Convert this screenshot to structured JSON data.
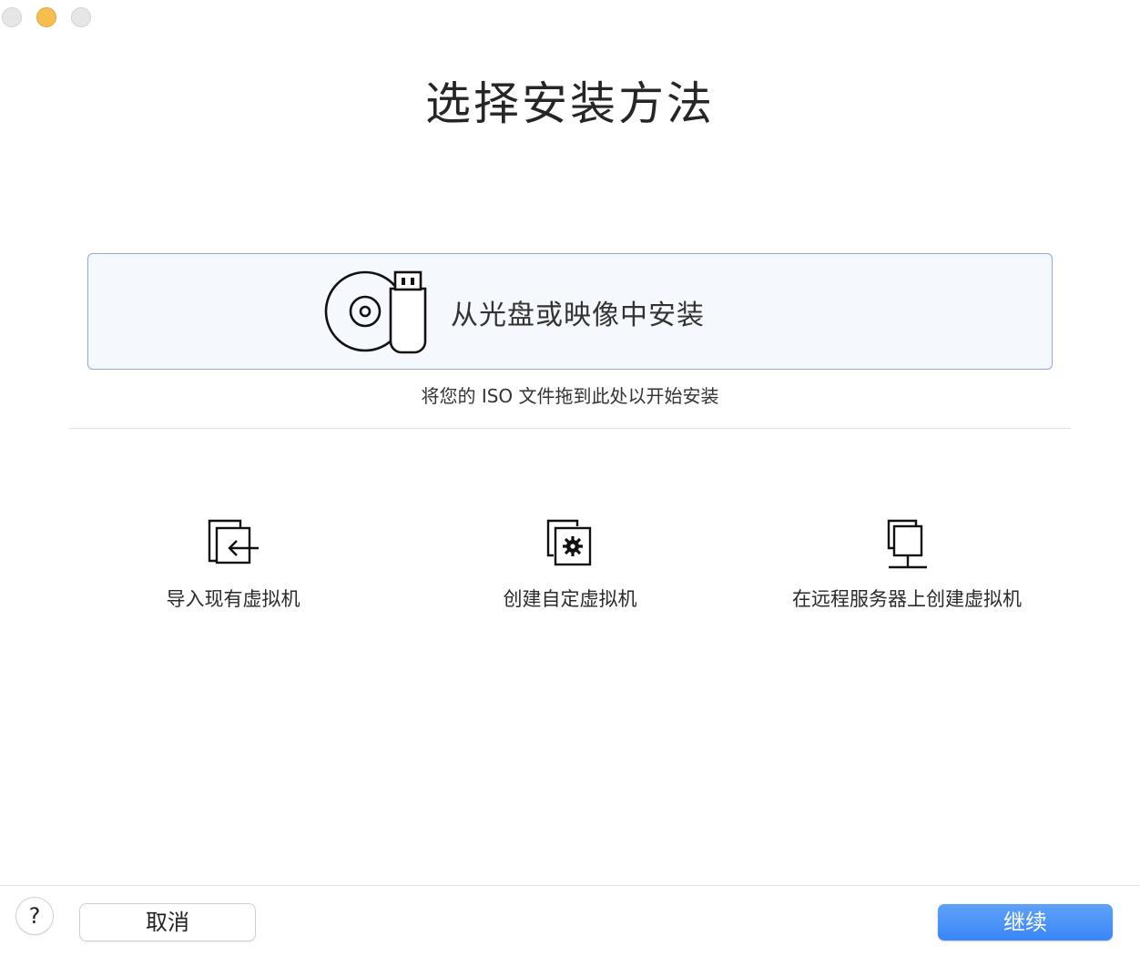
{
  "window": {
    "controls": [
      "close",
      "minimize",
      "zoom"
    ]
  },
  "header": {
    "title": "选择安装方法"
  },
  "install_card": {
    "label": "从光盘或映像中安装",
    "icon": "disc-usb-icon"
  },
  "drop_hint": "将您的 ISO 文件拖到此处以开始安装",
  "options": [
    {
      "label": "导入现有虚拟机",
      "icon": "import-vm-icon"
    },
    {
      "label": "创建自定虚拟机",
      "icon": "custom-vm-icon"
    },
    {
      "label": "在远程服务器上创建虚拟机",
      "icon": "remote-server-icon"
    }
  ],
  "footer": {
    "help_label": "?",
    "cancel_label": "取消",
    "continue_label": "继续"
  },
  "colors": {
    "accent": "#3a86f6",
    "card_border": "#8fa7e2",
    "card_background": "#f5f8fc",
    "minimize_light": "#f6bd4f"
  }
}
